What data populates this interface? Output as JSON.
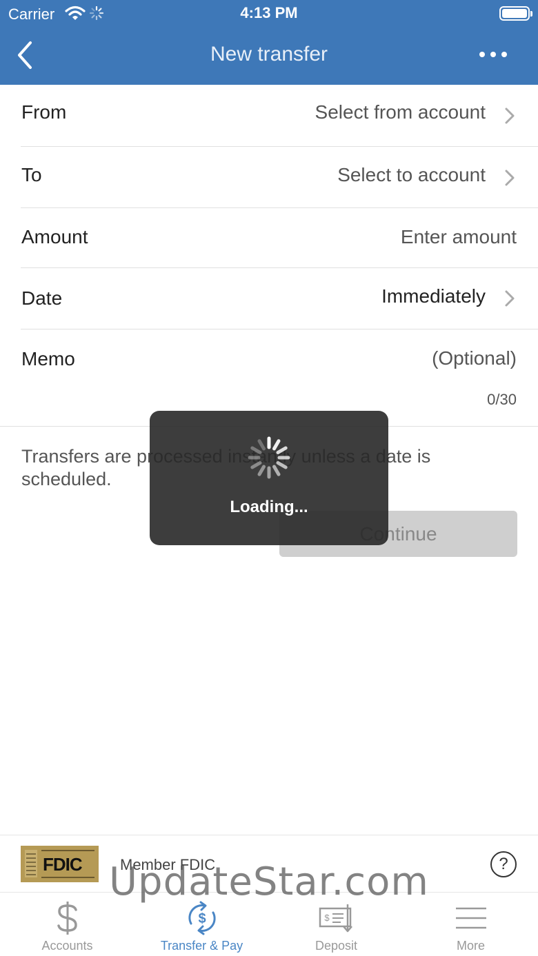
{
  "status_bar": {
    "carrier": "Carrier",
    "time": "4:13 PM"
  },
  "nav": {
    "title": "New transfer"
  },
  "form": {
    "from": {
      "label": "From",
      "value": "Select from account"
    },
    "to": {
      "label": "To",
      "value": "Select to account"
    },
    "amount": {
      "label": "Amount",
      "placeholder": "Enter amount"
    },
    "date": {
      "label": "Date",
      "value": "Immediately"
    },
    "memo": {
      "label": "Memo",
      "placeholder": "(Optional)",
      "count": "0/30"
    }
  },
  "info": "Transfers are processed instantly unless a date is scheduled.",
  "continue_label": "Continue",
  "loading": {
    "text": "Loading..."
  },
  "footer": {
    "member_fdic": "Member FDIC",
    "logo_text": "FDIC",
    "help": "?"
  },
  "tabs": [
    {
      "label": "Accounts",
      "icon": "dollar-icon",
      "active": false
    },
    {
      "label": "Transfer & Pay",
      "icon": "transfer-icon",
      "active": true
    },
    {
      "label": "Deposit",
      "icon": "check-deposit-icon",
      "active": false
    },
    {
      "label": "More",
      "icon": "menu-icon",
      "active": false
    }
  ],
  "watermark": "UpdateStar.com",
  "colors": {
    "header": "#3e78b8",
    "active_tab": "#4a86c5",
    "inactive_tab": "#999999"
  }
}
